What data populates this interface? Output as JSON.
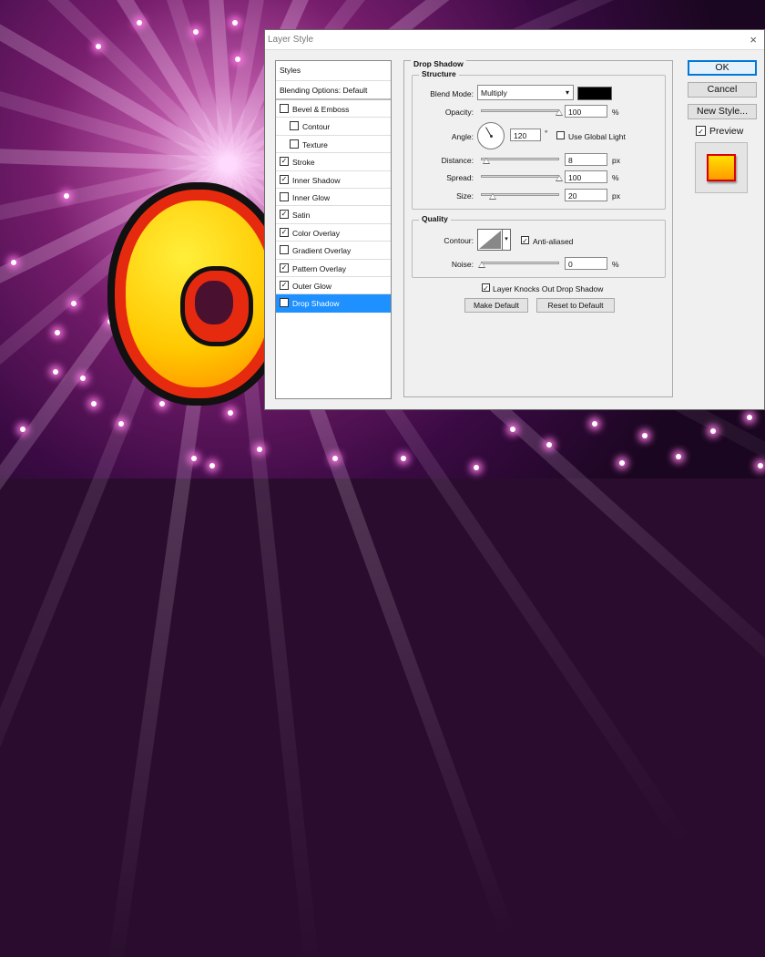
{
  "dialog": {
    "title": "Layer Style",
    "close_glyph": "×"
  },
  "styles_panel": {
    "header": "Styles",
    "blending": "Blending Options: Default",
    "items": [
      {
        "label": "Bevel & Emboss",
        "checked": false,
        "indent": false
      },
      {
        "label": "Contour",
        "checked": false,
        "indent": true
      },
      {
        "label": "Texture",
        "checked": false,
        "indent": true
      },
      {
        "label": "Stroke",
        "checked": true,
        "indent": false
      },
      {
        "label": "Inner Shadow",
        "checked": true,
        "indent": false
      },
      {
        "label": "Inner Glow",
        "checked": false,
        "indent": false
      },
      {
        "label": "Satin",
        "checked": true,
        "indent": false
      },
      {
        "label": "Color Overlay",
        "checked": true,
        "indent": false
      },
      {
        "label": "Gradient Overlay",
        "checked": false,
        "indent": false
      },
      {
        "label": "Pattern Overlay",
        "checked": true,
        "indent": false
      },
      {
        "label": "Outer Glow",
        "checked": true,
        "indent": false
      },
      {
        "label": "Drop Shadow",
        "checked": true,
        "indent": false,
        "active": true
      }
    ]
  },
  "drop_shadow": {
    "title": "Drop Shadow",
    "structure": {
      "title": "Structure",
      "blend_mode_label": "Blend Mode:",
      "blend_mode_value": "Multiply",
      "blend_color": "#000000",
      "opacity_label": "Opacity:",
      "opacity_value": "100",
      "opacity_unit": "%",
      "angle_label": "Angle:",
      "angle_value": "120",
      "angle_unit": "°",
      "global_light_label": "Use Global Light",
      "global_light_checked": false,
      "distance_label": "Distance:",
      "distance_value": "8",
      "distance_unit": "px",
      "spread_label": "Spread:",
      "spread_value": "100",
      "spread_unit": "%",
      "size_label": "Size:",
      "size_value": "20",
      "size_unit": "px"
    },
    "quality": {
      "title": "Quality",
      "contour_label": "Contour:",
      "antialiased_label": "Anti-aliased",
      "antialiased_checked": true,
      "noise_label": "Noise:",
      "noise_value": "0",
      "noise_unit": "%"
    },
    "knockout_label": "Layer Knocks Out Drop Shadow",
    "knockout_checked": true,
    "make_default": "Make Default",
    "reset_default": "Reset to Default"
  },
  "buttons": {
    "ok": "OK",
    "cancel": "Cancel",
    "new_style": "New Style...",
    "preview_label": "Preview",
    "preview_checked": true
  },
  "check_glyph": "✓",
  "dropdown_glyph": "▾",
  "colors": {
    "active_row": "#1e90ff",
    "ok_border": "#0078d7"
  }
}
